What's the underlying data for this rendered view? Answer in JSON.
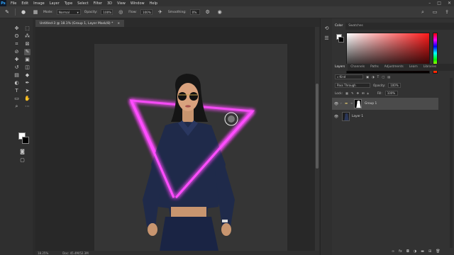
{
  "menubar": {
    "app_icon": "Ps",
    "items": [
      "File",
      "Edit",
      "Image",
      "Layer",
      "Type",
      "Select",
      "Filter",
      "3D",
      "View",
      "Window",
      "Help"
    ],
    "window_controls": [
      "minimize-icon",
      "maximize-icon",
      "close-icon"
    ]
  },
  "options": {
    "mode_label": "Mode:",
    "mode_value": "Normal",
    "opacity_label": "Opacity:",
    "opacity_value": "100%",
    "flow_label": "Flow:",
    "flow_value": "100%",
    "smoothing_label": "Smoothing:",
    "smoothing_value": "0%"
  },
  "document": {
    "tab_title": "Untitled-3 @ 18.1% (Group 1, Layer Mask/8) *",
    "tab_close": "×",
    "zoom": "18.25%",
    "doc_info": "Doc: 45.4M/52.3M"
  },
  "color_panel": {
    "tabs": [
      "Color",
      "Swatches"
    ],
    "foreground": "#ffffff",
    "background": "#000000",
    "hue_color": "#ff1a1a"
  },
  "layers_panel": {
    "tabs": [
      "Layers",
      "Channels",
      "Paths",
      "Adjustments",
      "Learn",
      "Libraries"
    ],
    "kind_label": "Kind",
    "blend_mode": "Pass Through",
    "opacity_label": "Opacity:",
    "opacity_value": "100%",
    "lock_label": "Lock:",
    "fill_label": "Fill:",
    "fill_value": "100%",
    "layers": [
      {
        "name": "Group 1",
        "selected": true
      },
      {
        "name": "Layer 1",
        "selected": false
      }
    ]
  },
  "colors": {
    "neon": "#ff4dff",
    "neon_glow": "#c020ff",
    "outfit": "#1f2a4a"
  }
}
